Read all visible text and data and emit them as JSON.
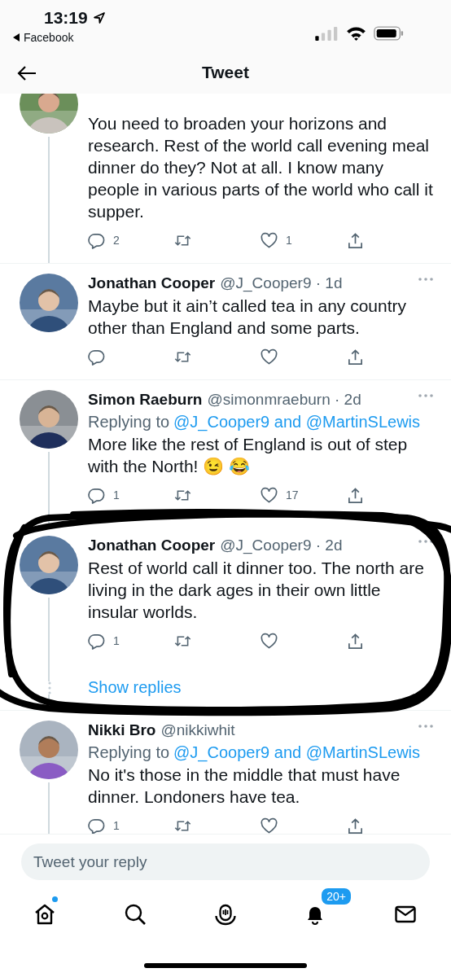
{
  "status_bar": {
    "time": "13:19",
    "back_app": "Facebook"
  },
  "header": {
    "title": "Tweet"
  },
  "tweets": [
    {
      "text": "You need to broaden your horizons and research. Rest of the world call evening meal dinner do they? Not at all. I know many people in various parts of the world who call it supper.",
      "counts": {
        "reply": "2",
        "like": "1"
      },
      "thread_line": true
    },
    {
      "name": "Jonathan Cooper",
      "handle": "@J_Cooper9 · 1d",
      "text": "Maybe but it ain’t called tea in any country other than England and some parts.",
      "thread_line": false
    },
    {
      "name": "Simon Raeburn",
      "handle": "@simonmraeburn · 2d",
      "replying": {
        "prefix": "Replying to",
        "mentions": "@J_Cooper9 and @MartinSLewis"
      },
      "text": "More like the rest of England is out of step with the North! 😉 😂",
      "counts": {
        "reply": "1",
        "like": "17"
      },
      "thread_line": true,
      "joined_below": true
    },
    {
      "name": "Jonathan Cooper",
      "handle": "@J_Cooper9 · 2d",
      "text": "Rest of world call it dinner too. The north are living in the dark ages in their own little insular worlds.",
      "counts": {
        "reply": "1"
      },
      "thread_line": true,
      "show_replies": "Show replies"
    },
    {
      "name": "Nikki Bro",
      "handle": "@nikkiwhit",
      "replying": {
        "prefix": "Replying to",
        "mentions": "@J_Cooper9 and @MartinSLewis"
      },
      "text": "No it's those in the middle that must have dinner. Londoners have tea.",
      "counts": {
        "reply": "1"
      },
      "thread_line": true
    }
  ],
  "reply_field": {
    "placeholder": "Tweet your reply"
  },
  "tab_bar": [
    {
      "kind": "home",
      "new_dot": true
    },
    {
      "kind": "search",
      "new_dot": false
    },
    {
      "kind": "spaces",
      "new_dot": false
    },
    {
      "kind": "notifications",
      "new_dot": false,
      "badge": "20+"
    },
    {
      "kind": "messages",
      "new_dot": false
    }
  ]
}
